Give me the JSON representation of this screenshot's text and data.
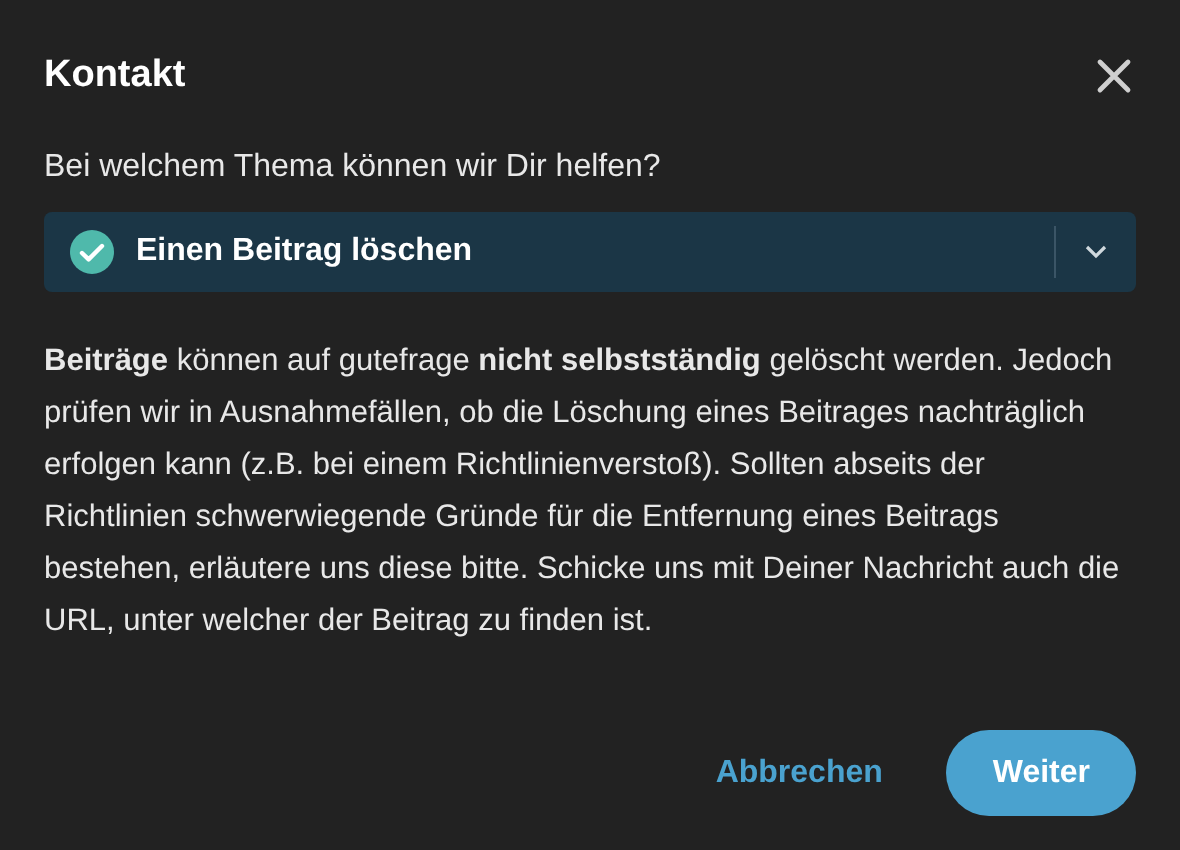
{
  "dialog": {
    "title": "Kontakt",
    "question": "Bei welchem Thema können wir Dir helfen?",
    "topic_select": {
      "value": "Einen Beitrag löschen",
      "valid": true
    },
    "message": "**Beiträge** können auf gutefrage **nicht selbstständig** gelöscht werden. Jedoch prüfen wir in Ausnahmefällen, ob die Löschung eines Beitrages nachträglich erfolgen kann (z.B. bei einem Richtlinienverstoß). Sollten abseits der Richtlinien schwerwiegende Gründe für die Entfernung eines Beitrags bestehen, erläutere uns diese bitte. Schicke uns mit Deiner Nachricht auch die URL, unter welcher der Beitrag zu finden ist.",
    "buttons": [
      {
        "label": "Abbrechen",
        "kind": "text"
      },
      {
        "label": "Weiter",
        "kind": "primary"
      }
    ]
  }
}
